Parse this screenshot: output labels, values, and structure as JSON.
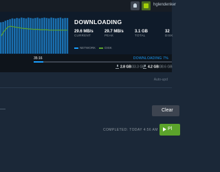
{
  "topbar": {
    "username": "hglendenker"
  },
  "header": {
    "title": "DOWNLOADING",
    "stats": [
      {
        "value": "29.6 MB/s",
        "label": "CURRENT"
      },
      {
        "value": "29.7 MB/s",
        "label": "PEAK"
      },
      {
        "value": "3.1 GB",
        "label": "TOTAL"
      },
      {
        "value": "32",
        "label": "DISK"
      }
    ],
    "legend": {
      "network": "NETWORK",
      "disk": "DISK"
    }
  },
  "progress": {
    "elapsed": "35:16",
    "status": "DOWNLOADING 7%",
    "fraction": 0.07,
    "downloaded": "2.8 GB",
    "downloaded_total": "/33.3 GB",
    "disk": "4.2 GB",
    "disk_total": "/38.6 GB"
  },
  "section": {
    "sub_label": "Auto-upd"
  },
  "buttons": {
    "clear": "Clear",
    "play": "Pl"
  },
  "completed": "COMPLETED: TODAY 4:56 AM",
  "colors": {
    "accent": "#1a9fff",
    "green": "#5ba32b",
    "background": "#1b2838"
  },
  "icons": [
    "notification-bell-icon",
    "user-avatar-icon",
    "download-icon",
    "disk-icon",
    "play-icon"
  ],
  "chart_data": {
    "type": "bar",
    "series": [
      {
        "name": "NETWORK",
        "values": [
          0.8,
          0.81,
          0.84,
          0.86,
          0.88,
          0.9,
          0.89,
          0.91,
          0.9,
          0.92,
          0.91,
          0.9,
          0.92,
          0.91,
          0.9,
          0.91,
          0.92,
          0.9,
          0.91,
          0.92,
          0.91,
          0.9,
          0.92,
          0.91,
          0.9,
          0.91,
          0.92,
          0.9,
          0.91,
          0.91
        ]
      },
      {
        "name": "DISK",
        "values": [
          0.45,
          0.55,
          0.62,
          0.68,
          0.7,
          0.69,
          0.68,
          0.67,
          0.66,
          0.65,
          0.64,
          0.64,
          0.63,
          0.63,
          0.62,
          0.62,
          0.62,
          0.61,
          0.61,
          0.61,
          0.61,
          0.6,
          0.6,
          0.6,
          0.6,
          0.6,
          0.6,
          0.6,
          0.6,
          0.6
        ]
      }
    ]
  }
}
